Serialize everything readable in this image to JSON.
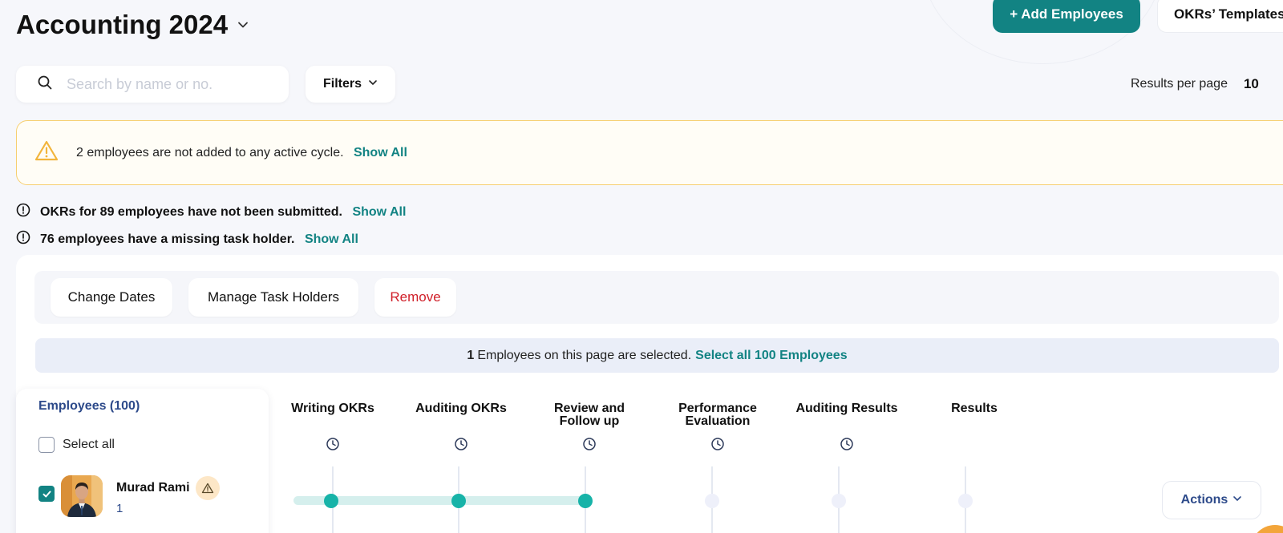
{
  "header": {
    "title": "Accounting 2024",
    "add_button": "+ Add Employees",
    "templates_button": "OKRs’ Templates"
  },
  "search": {
    "placeholder": "Search by name or no.",
    "value": ""
  },
  "filters_label": "Filters",
  "pagination": {
    "label": "Results per page",
    "value": "10"
  },
  "alerts": {
    "cycle": {
      "text": "2 employees are not added to any active cycle.",
      "link": "Show All"
    },
    "okrs": {
      "text": "OKRs for 89 employees have not been submitted.",
      "link": "Show All"
    },
    "holder": {
      "text": "76 employees have a missing task holder.",
      "link": "Show All"
    }
  },
  "toolbar": {
    "change_dates": "Change Dates",
    "manage_holders": "Manage Task Holders",
    "remove": "Remove"
  },
  "selection": {
    "count": "1",
    "text": "Employees on this page are selected.",
    "select_all_link": "Select all 100 Employees"
  },
  "employees_panel": {
    "title": "Employees (100)",
    "select_all": "Select all",
    "rows": [
      {
        "name": "Murad Rami",
        "number": "1",
        "selected": true
      }
    ]
  },
  "stages": [
    {
      "line1": "Writing OKRs",
      "line2": ""
    },
    {
      "line1": "Auditing OKRs",
      "line2": ""
    },
    {
      "line1": "Review and",
      "line2": "Follow up"
    },
    {
      "line1": "Performance",
      "line2": "Evaluation"
    },
    {
      "line1": "Auditing Results",
      "line2": ""
    },
    {
      "line1": "Results",
      "line2": ""
    }
  ],
  "progress": {
    "completed_stages": 3,
    "total_stages": 6
  },
  "actions_label": "Actions",
  "colors": {
    "primary": "#128383",
    "danger": "#d0202a",
    "warning": "#f2b53c",
    "progress_dot": "#17b3a8"
  }
}
